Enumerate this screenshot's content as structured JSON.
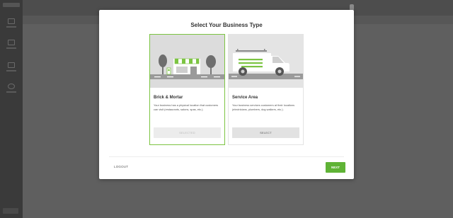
{
  "modal": {
    "title": "Select Your Business Type",
    "cards": [
      {
        "title": "Brick & Mortar",
        "description": "Your business has a physical location that customers can visit (restaurants, salons, spas, etc.).",
        "button_label": "SELECTED",
        "state": "selected",
        "icon": "storefront-illustration"
      },
      {
        "title": "Service Area",
        "description": "Your business services customers at their locations (electricians, plumbers, dog walkers, etc.).",
        "button_label": "SELECT",
        "state": "unselected",
        "icon": "van-illustration"
      }
    ],
    "logout_label": "LOGOUT",
    "next_label": "NEXT"
  },
  "colors": {
    "accent": "#7cc442",
    "next_button": "#5fb336",
    "overlay": "#5f5f5f"
  }
}
